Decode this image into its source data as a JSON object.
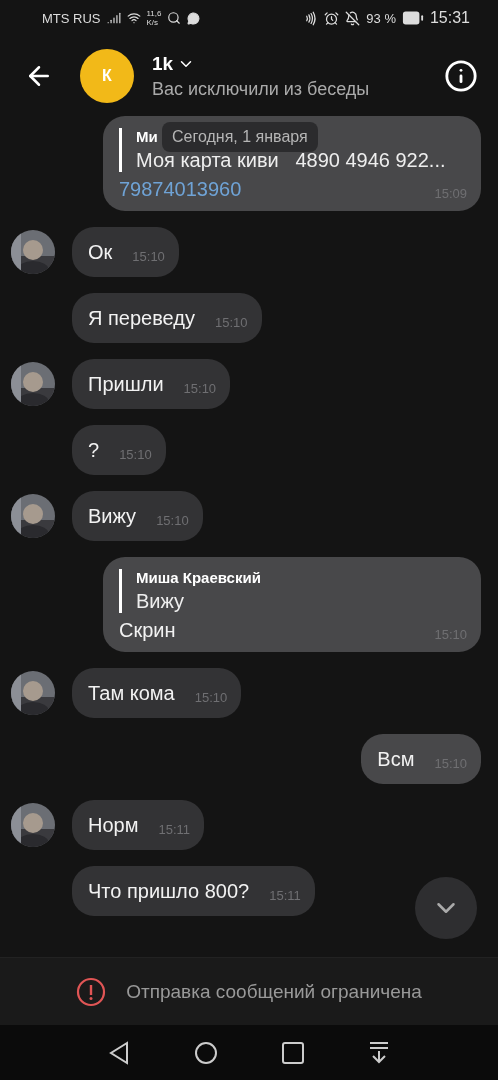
{
  "status_bar": {
    "carrier": "MTS RUS",
    "speed": [
      "11,6",
      "K/s"
    ],
    "battery": "93 %",
    "time": "15:31"
  },
  "header": {
    "avatar_letter": "К",
    "title": "1k",
    "subtitle": "Вас исключили из беседы"
  },
  "date_pill": "Сегодня, 1 января",
  "messages": [
    {
      "kind": "outgoing",
      "reply": {
        "author": "Ми",
        "text": "Моя карта киви   4890 4946 922..."
      },
      "link": "79874013960",
      "time": "15:09"
    },
    {
      "kind": "incoming",
      "avatar": true,
      "text": "Ок",
      "time": "15:10"
    },
    {
      "kind": "incoming",
      "avatar": false,
      "text": "Я переведу",
      "time": "15:10"
    },
    {
      "kind": "incoming",
      "avatar": true,
      "text": "Пришли",
      "time": "15:10"
    },
    {
      "kind": "incoming",
      "avatar": false,
      "text": "?",
      "time": "15:10"
    },
    {
      "kind": "incoming",
      "avatar": true,
      "text": "Вижу",
      "time": "15:10"
    },
    {
      "kind": "outgoing",
      "reply": {
        "author": "Миша Краевский",
        "text": "Вижу"
      },
      "text": "Скрин",
      "time": "15:10"
    },
    {
      "kind": "incoming",
      "avatar": true,
      "text": "Там кома",
      "time": "15:10"
    },
    {
      "kind": "outgoing",
      "text": "Всм",
      "time": "15:10"
    },
    {
      "kind": "incoming",
      "avatar": true,
      "text": "Норм",
      "time": "15:11"
    },
    {
      "kind": "incoming",
      "avatar": false,
      "text": "Что пришло 800?",
      "time": "15:11"
    }
  ],
  "notice": "Отправка сообщений ограничена"
}
